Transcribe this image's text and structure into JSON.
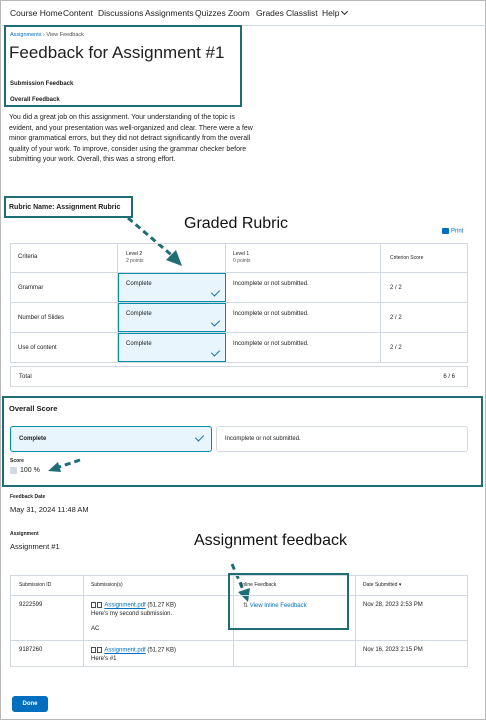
{
  "nav": {
    "items": [
      "Course Home",
      "Content",
      "Discussions",
      "Assignments",
      "Quizzes",
      "Zoom",
      "Grades",
      "Classlist",
      "Help"
    ]
  },
  "breadcrumb": {
    "parent": "Assignments",
    "separator": "›",
    "current": "View Feedback"
  },
  "header": {
    "title": "Feedback for Assignment #1",
    "submission_feedback": "Submission Feedback",
    "overall_feedback": "Overall Feedback"
  },
  "feedback_text": "You did a great job on this assignment. Your understanding of the topic is evident, and your presentation was well-organized and clear. There were a few minor grammatical errors, but they did not detract significantly from the overall quality of your work. To improve, consider using the grammar checker before submitting your work. Overall, this was a strong effort.",
  "rubric": {
    "name_label": "Rubric Name: Assignment Rubric",
    "annotation": "Graded Rubric",
    "print_label": "Print",
    "headers": {
      "criteria": "Criteria",
      "level2": "Level 2",
      "level2_points": "2 points",
      "level1": "Level 1",
      "level1_points": "0 points",
      "criterion_score": "Criterion Score"
    },
    "rows": [
      {
        "criterion": "Grammar",
        "level2": "Complete",
        "level1": "Incomplete or not submitted.",
        "score": "2 / 2"
      },
      {
        "criterion": "Number of Slides",
        "level2": "Complete",
        "level1": "Incomplete or not submitted.",
        "score": "2 / 2"
      },
      {
        "criterion": "Use of content",
        "level2": "Complete",
        "level1": "Incomplete or not submitted.",
        "score": "2 / 2"
      }
    ],
    "total_label": "Total",
    "total_value": "6 / 6"
  },
  "overall_score": {
    "title": "Overall Score",
    "option_selected": "Complete",
    "option_other": "Incomplete or not submitted.",
    "score_label": "Score",
    "score_value": "100 %"
  },
  "feedback_date": {
    "label": "Feedback Date",
    "value": "May 31, 2024 11:48 AM"
  },
  "assignment": {
    "label": "Assignment",
    "value": "Assignment #1",
    "annotation": "Assignment feedback"
  },
  "submissions": {
    "headers": [
      "Submission ID",
      "Submission(s)",
      "Inline Feedback",
      "Date Submitted"
    ],
    "rows": [
      {
        "id": "9222599",
        "file": "Assignment.pdf",
        "size": "(51.27 KB)",
        "comment": "Here's my second submission.",
        "initials": "AC",
        "inline": "View Inline Feedback",
        "date": "Nov 28, 2023 2:53 PM"
      },
      {
        "id": "9187260",
        "file": "Assignment.pdf",
        "size": "(51.27 KB)",
        "comment": "Here's #1",
        "inline": "",
        "date": "Nov 16, 2023 2:15 PM"
      }
    ]
  },
  "done_label": "Done",
  "colors": {
    "accent": "#006fbf",
    "annotation_box": "#1e6e74",
    "selected_bg": "#e8f5fd"
  }
}
